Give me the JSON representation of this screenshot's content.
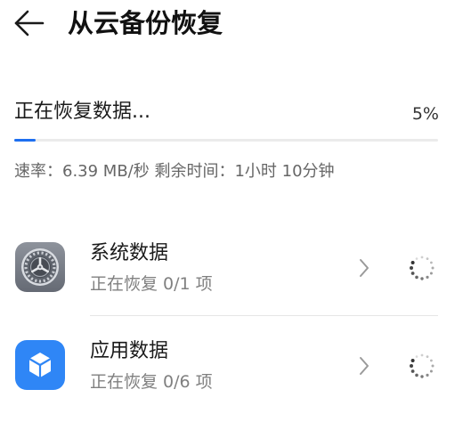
{
  "header": {
    "title": "从云备份恢复"
  },
  "progress": {
    "status_text": "正在恢复数据...",
    "percent_text": "5%",
    "percent": 5,
    "speed_text": "速率：6.39 MB/秒  剩余时间：1小时 10分钟"
  },
  "items": [
    {
      "title": "系统数据",
      "subtitle": "正在恢复 0/1 项",
      "icon": "settings-gear-icon"
    },
    {
      "title": "应用数据",
      "subtitle": "正在恢复 0/6 项",
      "icon": "app-cube-icon"
    }
  ],
  "colors": {
    "accent": "#1e6ff0",
    "app_icon_bg": "#2f86f6",
    "system_icon_bg": "#767b86"
  }
}
